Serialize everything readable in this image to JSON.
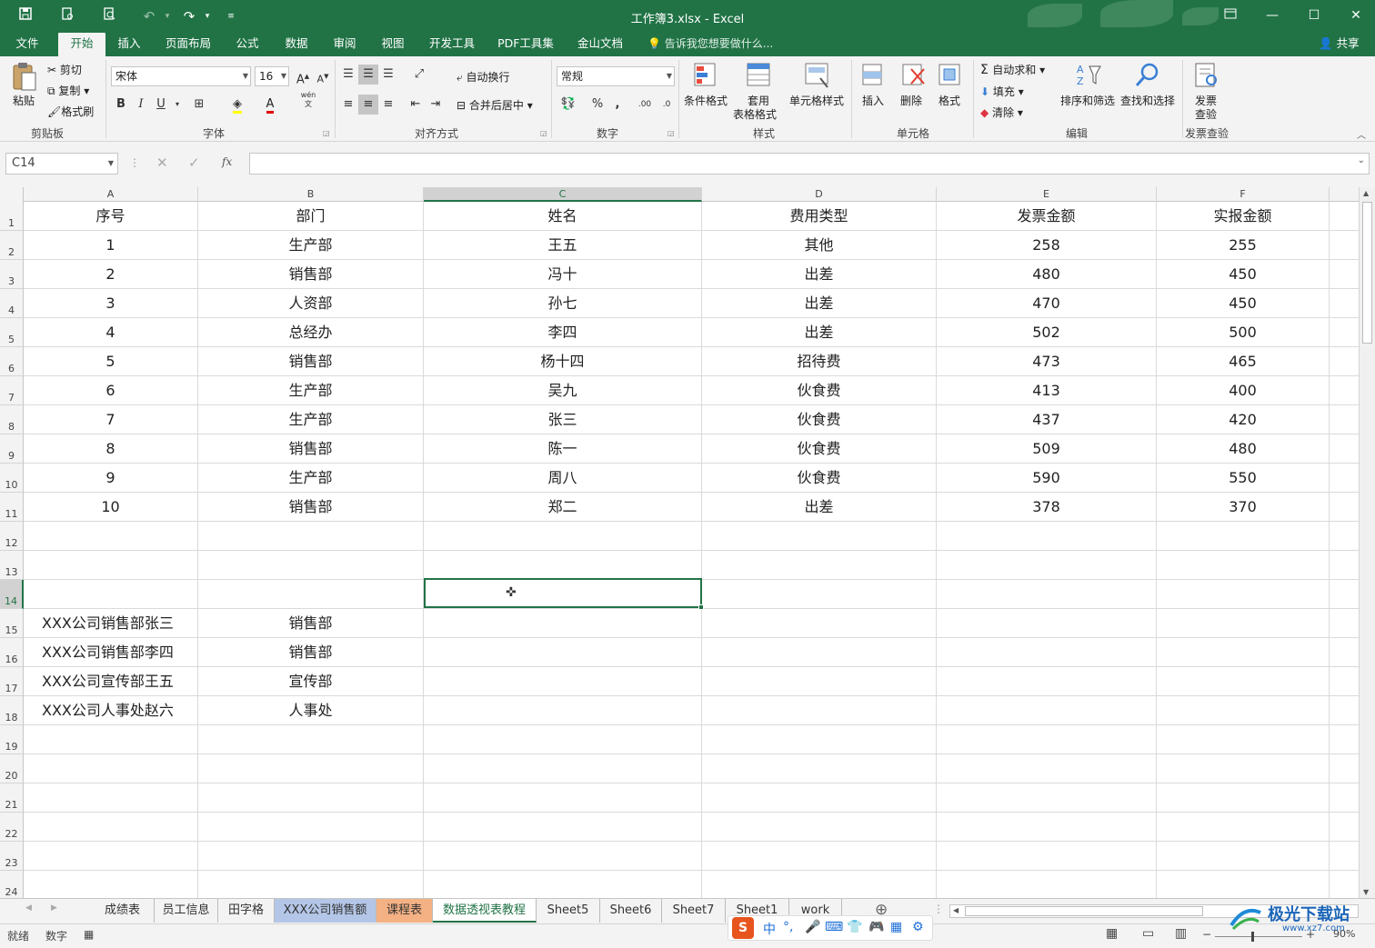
{
  "window": {
    "title": "工作簿3.xlsx - Excel",
    "min_icon": "minimize-icon",
    "max_icon": "maximize-icon",
    "close_icon": "close-icon"
  },
  "quick_access": [
    "save-icon",
    "print-preview-icon",
    "print-icon",
    "undo-icon",
    "redo-icon",
    "customize-icon"
  ],
  "menu": {
    "tabs": [
      "文件",
      "开始",
      "插入",
      "页面布局",
      "公式",
      "数据",
      "审阅",
      "视图",
      "开发工具",
      "PDF工具集",
      "金山文档"
    ],
    "active": "开始",
    "tell_me": "告诉我您想要做什么...",
    "share": "共享"
  },
  "ribbon": {
    "clipboard": {
      "paste": "粘贴",
      "cut": "剪切",
      "copy": "复制",
      "format_painter": "格式刷",
      "label": "剪贴板"
    },
    "font": {
      "name": "宋体",
      "size": "16",
      "bold": "B",
      "italic": "I",
      "underline": "U",
      "label": "字体",
      "wen": "wén"
    },
    "alignment": {
      "wrap": "自动换行",
      "merge": "合并后居中",
      "label": "对齐方式"
    },
    "number": {
      "format": "常规",
      "percent": "%",
      "comma": ",",
      "label": "数字"
    },
    "styles": {
      "conditional": "条件格式",
      "table_fmt_1": "套用",
      "table_fmt_2": "表格格式",
      "cell_styles": "单元格样式",
      "label": "样式"
    },
    "cells": {
      "insert": "插入",
      "delete": "删除",
      "format": "格式",
      "label": "单元格"
    },
    "editing": {
      "autosum": "自动求和",
      "fill": "填充",
      "clear": "清除",
      "sort": "排序和筛选",
      "find": "查找和选择",
      "label": "编辑"
    },
    "invoice": {
      "btn_1": "发票",
      "btn_2": "查验",
      "label": "发票查验"
    }
  },
  "formula_bar": {
    "name_box": "C14",
    "fx": "fx",
    "formula": ""
  },
  "columns": [
    "A",
    "B",
    "C",
    "D",
    "E",
    "F"
  ],
  "selected_column": "C",
  "selected_row": "14",
  "rows": [
    {
      "n": "1",
      "cells": [
        "序号",
        "部门",
        "姓名",
        "费用类型",
        "发票金额",
        "实报金额"
      ]
    },
    {
      "n": "2",
      "cells": [
        "1",
        "生产部",
        "王五",
        "其他",
        "258",
        "255"
      ]
    },
    {
      "n": "3",
      "cells": [
        "2",
        "销售部",
        "冯十",
        "出差",
        "480",
        "450"
      ]
    },
    {
      "n": "4",
      "cells": [
        "3",
        "人资部",
        "孙七",
        "出差",
        "470",
        "450"
      ]
    },
    {
      "n": "5",
      "cells": [
        "4",
        "总经办",
        "李四",
        "出差",
        "502",
        "500"
      ]
    },
    {
      "n": "6",
      "cells": [
        "5",
        "销售部",
        "杨十四",
        "招待费",
        "473",
        "465"
      ]
    },
    {
      "n": "7",
      "cells": [
        "6",
        "生产部",
        "吴九",
        "伙食费",
        "413",
        "400"
      ]
    },
    {
      "n": "8",
      "cells": [
        "7",
        "生产部",
        "张三",
        "伙食费",
        "437",
        "420"
      ]
    },
    {
      "n": "9",
      "cells": [
        "8",
        "销售部",
        "陈一",
        "伙食费",
        "509",
        "480"
      ]
    },
    {
      "n": "10",
      "cells": [
        "9",
        "生产部",
        "周八",
        "伙食费",
        "590",
        "550"
      ]
    },
    {
      "n": "11",
      "cells": [
        "10",
        "销售部",
        "郑二",
        "出差",
        "378",
        "370"
      ]
    },
    {
      "n": "12",
      "cells": [
        "",
        "",
        "",
        "",
        "",
        ""
      ]
    },
    {
      "n": "13",
      "cells": [
        "",
        "",
        "",
        "",
        "",
        ""
      ]
    },
    {
      "n": "14",
      "cells": [
        "",
        "",
        "",
        "",
        "",
        ""
      ]
    },
    {
      "n": "15",
      "cells": [
        "XXX公司销售部张三",
        "销售部",
        "",
        "",
        "",
        ""
      ]
    },
    {
      "n": "16",
      "cells": [
        "XXX公司销售部李四",
        "销售部",
        "",
        "",
        "",
        ""
      ]
    },
    {
      "n": "17",
      "cells": [
        "XXX公司宣传部王五",
        "宣传部",
        "",
        "",
        "",
        ""
      ]
    },
    {
      "n": "18",
      "cells": [
        "XXX公司人事处赵六",
        "人事处",
        "",
        "",
        "",
        ""
      ]
    },
    {
      "n": "19",
      "cells": [
        "",
        "",
        "",
        "",
        "",
        ""
      ]
    },
    {
      "n": "20",
      "cells": [
        "",
        "",
        "",
        "",
        "",
        ""
      ]
    },
    {
      "n": "21",
      "cells": [
        "",
        "",
        "",
        "",
        "",
        ""
      ]
    },
    {
      "n": "22",
      "cells": [
        "",
        "",
        "",
        "",
        "",
        ""
      ]
    },
    {
      "n": "23",
      "cells": [
        "",
        "",
        "",
        "",
        "",
        ""
      ]
    },
    {
      "n": "24",
      "cells": [
        "",
        "",
        "",
        "",
        "",
        ""
      ]
    }
  ],
  "sheets": [
    {
      "name": "成绩表",
      "color": ""
    },
    {
      "name": "员工信息",
      "color": ""
    },
    {
      "name": "田字格",
      "color": ""
    },
    {
      "name": "XXX公司销售额",
      "color": "#b4c6e7"
    },
    {
      "name": "课程表",
      "color": "#f4b183"
    },
    {
      "name": "数据透视表教程",
      "color": ""
    },
    {
      "name": "Sheet5",
      "color": ""
    },
    {
      "name": "Sheet6",
      "color": ""
    },
    {
      "name": "Sheet7",
      "color": ""
    },
    {
      "name": "Sheet1",
      "color": ""
    },
    {
      "name": "work",
      "color": ""
    }
  ],
  "active_sheet": "数据透视表教程",
  "status": {
    "ready": "就绪",
    "num": "数字",
    "zoom": "90%"
  },
  "ime": {
    "mode": "中",
    "icons": [
      "mic-icon",
      "keyboard-icon",
      "shirt-icon",
      "game-icon",
      "apps-icon",
      "settings-icon"
    ]
  },
  "watermark": {
    "text": "极光下载站",
    "url": "www.xz7.com"
  },
  "colors": {
    "accent": "#217346",
    "ribbon_bg": "#f3f3f3"
  }
}
